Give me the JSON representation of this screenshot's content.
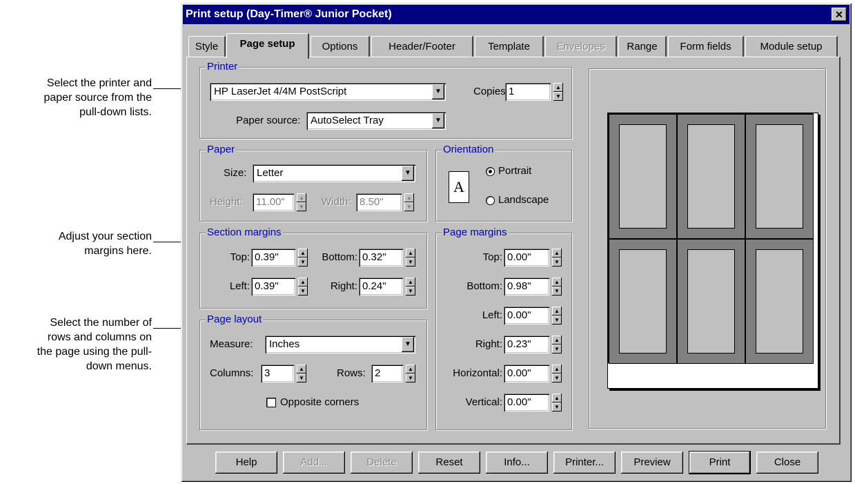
{
  "annotations": [
    {
      "lines": [
        "Select the printer and",
        "paper source from the",
        "pull-down lists."
      ]
    },
    {
      "lines": [
        "Adjust your section",
        "margins here."
      ]
    },
    {
      "lines": [
        "Select the number of",
        "rows and columns on",
        "the page using the pull-",
        "down menus."
      ]
    }
  ],
  "dialog": {
    "title": "Print setup (Day-Timer® Junior Pocket)",
    "close_glyph": "✕"
  },
  "tabs": [
    {
      "label": "Style",
      "active": false,
      "enabled": true
    },
    {
      "label": "Page setup",
      "active": true,
      "enabled": true
    },
    {
      "label": "Options",
      "active": false,
      "enabled": true
    },
    {
      "label": "Header/Footer",
      "active": false,
      "enabled": true
    },
    {
      "label": "Template",
      "active": false,
      "enabled": true
    },
    {
      "label": "Envelopes",
      "active": false,
      "enabled": false
    },
    {
      "label": "Range",
      "active": false,
      "enabled": true
    },
    {
      "label": "Form fields",
      "active": false,
      "enabled": true
    },
    {
      "label": "Module setup",
      "active": false,
      "enabled": true
    }
  ],
  "printer_group": {
    "label": "Printer",
    "printer_value": "HP LaserJet 4/4M PostScript",
    "copies_label": "Copies:",
    "copies_value": "1",
    "paper_source_label": "Paper source:",
    "paper_source_value": "AutoSelect Tray"
  },
  "paper_group": {
    "label": "Paper",
    "size_label": "Size:",
    "size_value": "Letter",
    "height_label": "Height:",
    "height_value": "11.00\"",
    "width_label": "Width:",
    "width_value": "8.50\""
  },
  "orientation_group": {
    "label": "Orientation",
    "icon_letter": "A",
    "portrait_label": "Portrait",
    "landscape_label": "Landscape",
    "selected": "portrait"
  },
  "section_margins": {
    "label": "Section margins",
    "top_label": "Top:",
    "top_value": "0.39\"",
    "bottom_label": "Bottom:",
    "bottom_value": "0.32\"",
    "left_label": "Left:",
    "left_value": "0.39\"",
    "right_label": "Right:",
    "right_value": "0.24\""
  },
  "page_layout": {
    "label": "Page layout",
    "measure_label": "Measure:",
    "measure_value": "Inches",
    "columns_label": "Columns:",
    "columns_value": "3",
    "rows_label": "Rows:",
    "rows_value": "2",
    "opposite_corners_label": "Opposite corners",
    "opposite_corners_checked": false
  },
  "page_margins": {
    "label": "Page margins",
    "top_label": "Top:",
    "top_value": "0.00\"",
    "bottom_label": "Bottom:",
    "bottom_value": "0.98\"",
    "left_label": "Left:",
    "left_value": "0.00\"",
    "right_label": "Right:",
    "right_value": "0.23\"",
    "horizontal_label": "Horizontal:",
    "horizontal_value": "0.00\"",
    "vertical_label": "Vertical:",
    "vertical_value": "0.00\""
  },
  "buttons": {
    "help": "Help",
    "add": "Add...",
    "delete": "Delete",
    "reset": "Reset",
    "info": "Info...",
    "printer": "Printer...",
    "preview": "Preview",
    "print": "Print",
    "close": "Close"
  },
  "icons": {
    "spin_up": "▲",
    "spin_down": "▼",
    "dropdown_arrow": "▼"
  }
}
